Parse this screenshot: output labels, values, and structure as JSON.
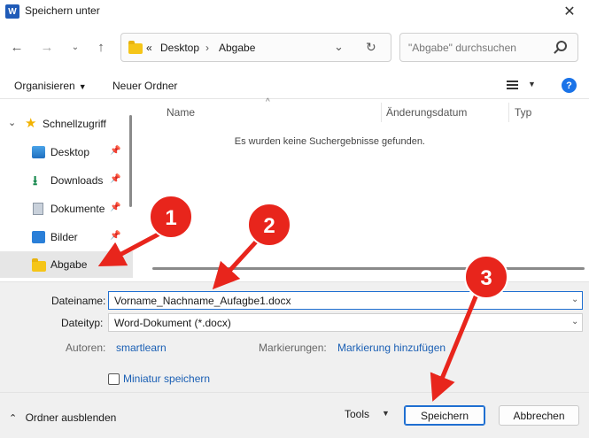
{
  "window": {
    "title": "Speichern unter",
    "app_icon_letter": "W"
  },
  "nav": {
    "path_prefix": "«",
    "breadcrumb": [
      "Desktop",
      "Abgabe"
    ],
    "breadcrumb_sep": "›",
    "search_placeholder": "\"Abgabe\" durchsuchen"
  },
  "toolbar": {
    "organize": "Organisieren",
    "new_folder": "Neuer Ordner"
  },
  "sidebar": {
    "items": [
      {
        "label": "Schnellzugriff",
        "icon": "star-icon"
      },
      {
        "label": "Desktop",
        "icon": "desktop-icon"
      },
      {
        "label": "Downloads",
        "icon": "download-icon"
      },
      {
        "label": "Dokumente",
        "icon": "documents-icon"
      },
      {
        "label": "Bilder",
        "icon": "pictures-icon"
      },
      {
        "label": "Abgabe",
        "icon": "folder-icon"
      }
    ]
  },
  "columns": {
    "name": "Name",
    "date": "Änderungsdatum",
    "type": "Typ"
  },
  "empty_message": "Es wurden keine Suchergebnisse gefunden.",
  "form": {
    "filename_label": "Dateiname:",
    "filename_value": "Vorname_Nachname_Aufagbe1.docx",
    "filetype_label": "Dateityp:",
    "filetype_value": "Word-Dokument (*.docx)",
    "authors_label": "Autoren:",
    "authors_value": "smartlearn",
    "tags_label": "Markierungen:",
    "tags_value": "Markierung hinzufügen",
    "thumbnail_label": "Miniatur speichern"
  },
  "footer": {
    "hide_folders": "Ordner ausblenden",
    "tools": "Tools",
    "save": "Speichern",
    "cancel": "Abbrechen"
  },
  "annotations": {
    "badges": [
      "1",
      "2",
      "3"
    ],
    "color": "#e8251c"
  }
}
